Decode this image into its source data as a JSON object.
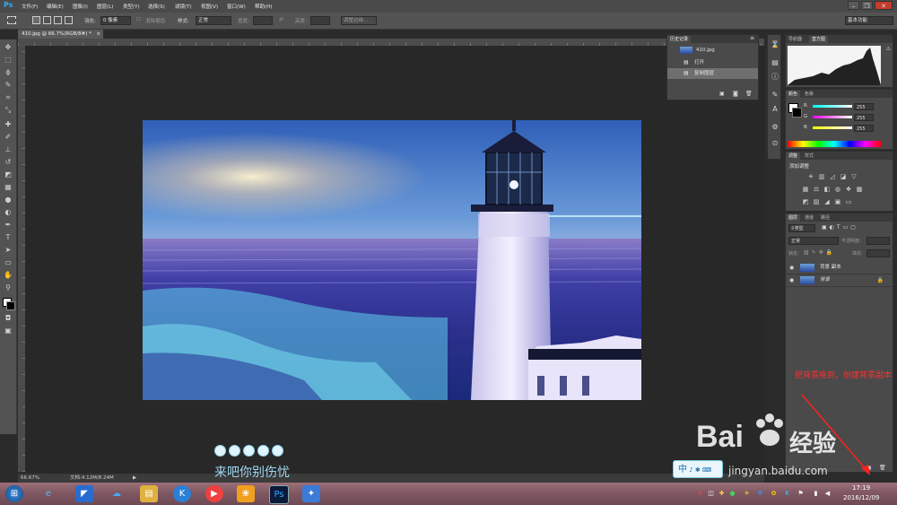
{
  "app": {
    "logo": "Ps"
  },
  "menu": [
    "文件(F)",
    "编辑(E)",
    "图像(I)",
    "图层(L)",
    "类型(Y)",
    "选择(S)",
    "滤镜(T)",
    "视图(V)",
    "窗口(W)",
    "帮助(H)"
  ],
  "options": {
    "feather_label": "羽化:",
    "feather_value": "0 像素",
    "antialias_label": "消除锯齿",
    "style_label": "样式:",
    "style_value": "正常",
    "width_label": "宽度:",
    "height_label": "高度:",
    "refine_edge": "调整边缘...",
    "workspace": "基本功能"
  },
  "document": {
    "tab_title": "410.jpg @ 66.7%(RGB/8#) *",
    "tab_close": "×",
    "status_zoom": "66.67%",
    "status_doc": "文档:4.12M/8.24M"
  },
  "history": {
    "tab": "历史记录",
    "snapshot": "410.jpg",
    "items": [
      "打开",
      "复制图层"
    ]
  },
  "navigator": {
    "tabs": [
      "导航器",
      "直方图"
    ]
  },
  "color": {
    "tabs": [
      "颜色",
      "色板"
    ],
    "channels": [
      {
        "label": "R",
        "value": "255"
      },
      {
        "label": "G",
        "value": "255"
      },
      {
        "label": "B",
        "value": "255"
      }
    ]
  },
  "adjustments": {
    "tabs": [
      "调整",
      "样式"
    ],
    "heading": "添加调整"
  },
  "layers": {
    "tabs": [
      "图层",
      "通道",
      "路径"
    ],
    "kind": "类型",
    "blend_mode": "正常",
    "opacity_label": "不透明度:",
    "lock_label": "锁定:",
    "fill_label": "填充:",
    "items": [
      {
        "name": "背景 副本"
      },
      {
        "name": "背景"
      }
    ]
  },
  "overlay": {
    "annotation": "把背景拖到，创建背景副本",
    "caption": "来吧你别伤忧",
    "baidu_logo": "Bai",
    "baidu_jingyan": "经验",
    "baidu_url": "jingyan.baidu.com",
    "ime_text": "中"
  },
  "taskbar": {
    "time": "17:19",
    "date": "2016/12/09",
    "apps": [
      "start",
      "ie",
      "app-blue",
      "baidu-cloud",
      "file-explorer",
      "app-k",
      "media-player",
      "qq-game",
      "photoshop",
      "game-controller"
    ]
  }
}
